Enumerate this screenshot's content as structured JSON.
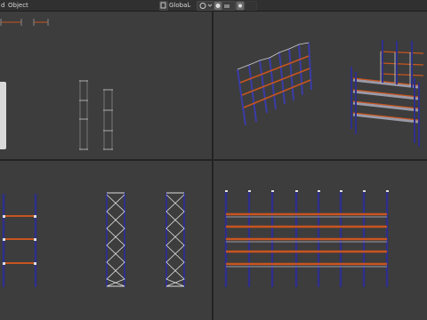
{
  "header": {
    "mode_label": "Object",
    "orientation_label": "Global",
    "left_glyph": "d",
    "icons": [
      "transform-pivot-icon",
      "snap-icon",
      "proportional-edit-icon",
      "overlay-icon"
    ]
  },
  "viewports": [
    {
      "name": "left-orthographic-view"
    },
    {
      "name": "perspective-view"
    },
    {
      "name": "front-orthographic-view"
    },
    {
      "name": "side-orthographic-view"
    }
  ],
  "colors": {
    "upright": "#2e2f8c",
    "beam": "#c8551f",
    "shelf": "#9a9aa8",
    "wire": "#e0e0e0"
  }
}
